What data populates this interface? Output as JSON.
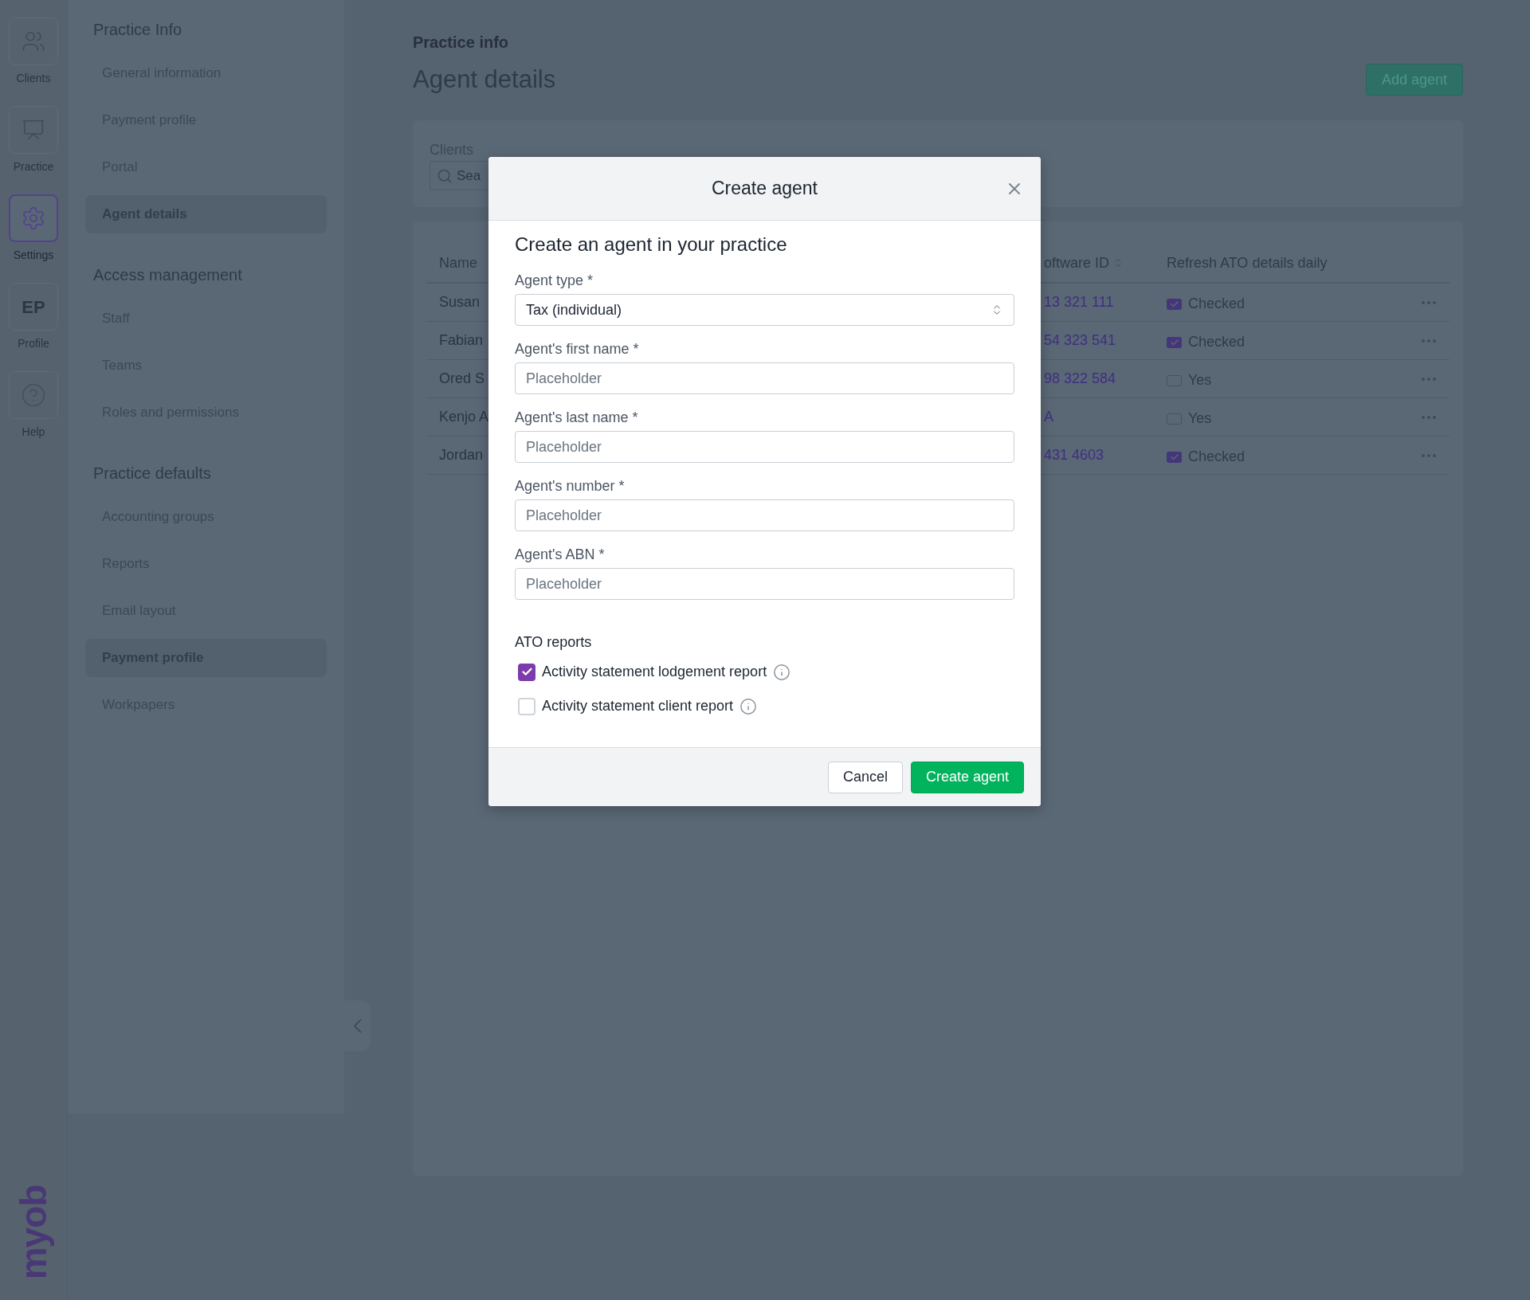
{
  "rail": {
    "items": [
      {
        "kind": "clients",
        "label": "Clients",
        "selected": false
      },
      {
        "kind": "practice",
        "label": "Practice",
        "selected": false
      },
      {
        "kind": "settings",
        "label": "Settings",
        "selected": true
      },
      {
        "kind": "initials",
        "initials": "EP",
        "label": "Profile",
        "selected": false
      },
      {
        "kind": "help",
        "label": "Help",
        "selected": false
      }
    ],
    "logo": "myob"
  },
  "sidebar": {
    "sections": [
      {
        "title": "Practice Info",
        "items": [
          {
            "label": "General information",
            "selected": false
          },
          {
            "label": "Payment profile",
            "selected": false
          },
          {
            "label": "Portal",
            "selected": false
          },
          {
            "label": "Agent details",
            "selected": true
          }
        ]
      },
      {
        "title": "Access management",
        "items": [
          {
            "label": "Staff",
            "selected": false
          },
          {
            "label": "Teams",
            "selected": false
          },
          {
            "label": "Roles and permissions",
            "selected": false
          }
        ]
      },
      {
        "title": "Practice defaults",
        "items": [
          {
            "label": "Accounting groups",
            "selected": false
          },
          {
            "label": "Reports",
            "selected": false
          },
          {
            "label": "Email layout",
            "selected": false
          },
          {
            "label": "Payment profile",
            "selected": true
          },
          {
            "label": "Workpapers",
            "selected": false
          }
        ]
      }
    ]
  },
  "page": {
    "breadcrumb": "Practice info",
    "title": "Agent details",
    "add_button": "Add agent"
  },
  "filter": {
    "label": "Clients",
    "search_placeholder": "Sea"
  },
  "table": {
    "columns": [
      "Name",
      "oftware ID",
      "Refresh ATO details daily"
    ],
    "rows": [
      {
        "name": "Susan",
        "software_id": "13 321 111",
        "refresh": {
          "checked": true,
          "label": "Checked"
        }
      },
      {
        "name": "Fabian",
        "software_id": "54 323 541",
        "refresh": {
          "checked": true,
          "label": "Checked"
        }
      },
      {
        "name": "Ored S",
        "software_id": "98 322 584",
        "refresh": {
          "checked": false,
          "label": "Yes"
        }
      },
      {
        "name": "Kenjo A",
        "software_id": "A",
        "refresh": {
          "checked": false,
          "label": "Yes"
        }
      },
      {
        "name": "Jordan",
        "software_id": "431 4603",
        "refresh": {
          "checked": true,
          "label": "Checked"
        }
      }
    ]
  },
  "modal": {
    "title": "Create agent",
    "heading": "Create an agent in your practice",
    "fields": [
      {
        "kind": "select",
        "label": "Agent type",
        "required_mark": "*",
        "value": "Tax (individual)"
      },
      {
        "kind": "text",
        "label": "Agent's first name",
        "required_mark": "*",
        "placeholder": "Placeholder"
      },
      {
        "kind": "text",
        "label": "Agent's last name",
        "required_mark": "*",
        "placeholder": "Placeholder"
      },
      {
        "kind": "text",
        "label": "Agent's number",
        "required_mark": "*",
        "placeholder": "Placeholder"
      },
      {
        "kind": "text",
        "label": "Agent's ABN",
        "required_mark": "*",
        "placeholder": "Placeholder"
      }
    ],
    "reports_title": "ATO reports",
    "reports": [
      {
        "label": "Activity statement lodgement report",
        "checked": true
      },
      {
        "label": "Activity statement client report",
        "checked": false
      }
    ],
    "buttons": [
      {
        "kind": "secondary",
        "label": "Cancel"
      },
      {
        "kind": "primary",
        "label": "Create agent"
      }
    ]
  }
}
